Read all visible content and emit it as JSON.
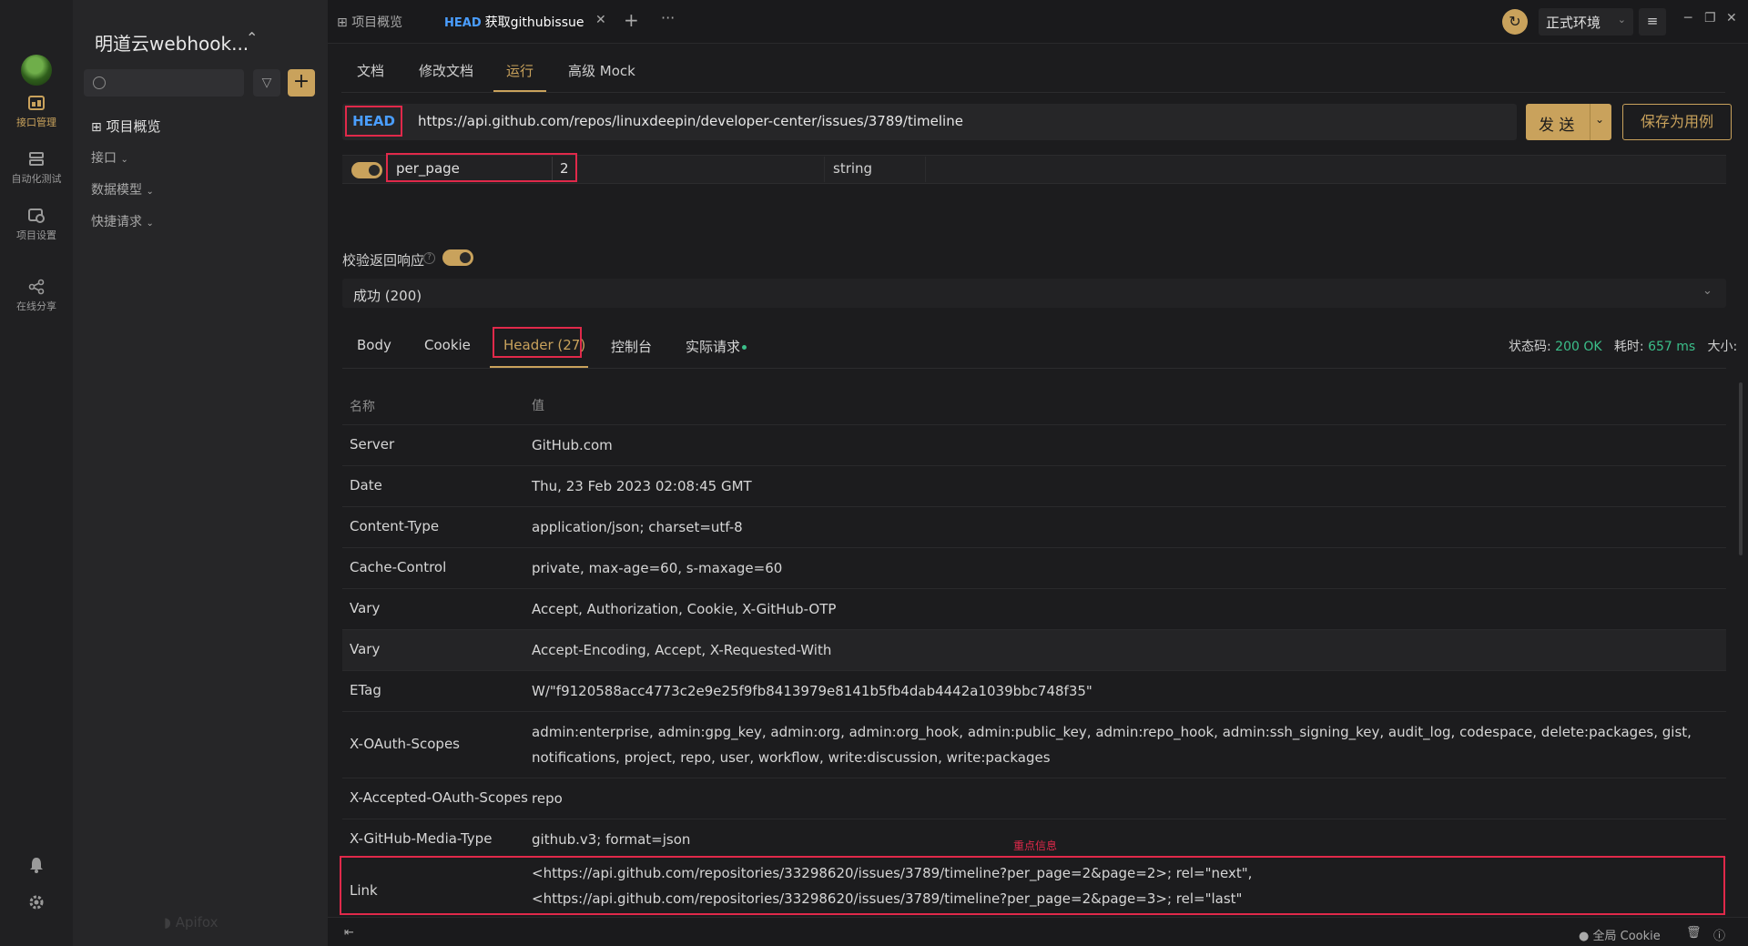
{
  "rail": {
    "items": [
      {
        "label": "接口管理",
        "icon": "api-management-icon"
      },
      {
        "label": "自动化测试",
        "icon": "automated-testing-icon"
      },
      {
        "label": "项目设置",
        "icon": "project-settings-icon"
      },
      {
        "label": "在线分享",
        "icon": "share-icon"
      }
    ]
  },
  "sidebar": {
    "project_title": "明道云webhook...",
    "overview": "项目概览",
    "items": [
      "接口",
      "数据模型",
      "快捷请求"
    ],
    "watermark": "Apifox"
  },
  "tabs": {
    "overview": "项目概览",
    "active_method": "HEAD",
    "active_title": "获取githubissue"
  },
  "env": {
    "name": "正式环境"
  },
  "subtabs": [
    "文档",
    "修改文档",
    "运行",
    "高级 Mock"
  ],
  "request": {
    "method": "HEAD",
    "url": "https://api.github.com/repos/linuxdeepin/developer-center/issues/3789/timeline",
    "send_label": "发 送",
    "save_label": "保存为用例"
  },
  "param": {
    "key": "per_page",
    "value": "2",
    "type": "string"
  },
  "validate": {
    "label": "校验返回响应",
    "response": "成功 (200)"
  },
  "resp_tabs": [
    "Body",
    "Cookie",
    "Header (27)",
    "控制台",
    "实际请求"
  ],
  "status": {
    "code_label": "状态码:",
    "code": "200 OK",
    "time_label": "耗时:",
    "time": "657 ms",
    "size_label": "大小:"
  },
  "headers": {
    "col_name": "名称",
    "col_value": "值",
    "rows": [
      {
        "name": "Server",
        "value": "GitHub.com"
      },
      {
        "name": "Date",
        "value": "Thu, 23 Feb 2023 02:08:45 GMT"
      },
      {
        "name": "Content-Type",
        "value": "application/json; charset=utf-8"
      },
      {
        "name": "Cache-Control",
        "value": "private, max-age=60, s-maxage=60"
      },
      {
        "name": "Vary",
        "value": "Accept, Authorization, Cookie, X-GitHub-OTP"
      },
      {
        "name": "Vary",
        "value": "Accept-Encoding, Accept, X-Requested-With"
      },
      {
        "name": "ETag",
        "value": "W/\"f9120588acc4773c2e9e25f9fb8413979e8141b5fb4dab4442a1039bbc748f35\""
      },
      {
        "name": "X-OAuth-Scopes",
        "value": "admin:enterprise, admin:gpg_key, admin:org, admin:org_hook, admin:public_key, admin:repo_hook, admin:ssh_signing_key, audit_log, codespace, delete:packages, gist, notifications, project, repo, user, workflow, write:discussion, write:packages"
      },
      {
        "name": "X-Accepted-OAuth-Scopes",
        "value": "repo"
      },
      {
        "name": "X-GitHub-Media-Type",
        "value": "github.v3; format=json"
      },
      {
        "name": "Link",
        "value": "<https://api.github.com/repositories/33298620/issues/3789/timeline?per_page=2&page=2>; rel=\"next\", <https://api.github.com/repositories/33298620/issues/3789/timeline?per_page=2&page=3>; rel=\"last\""
      }
    ],
    "note": "重点信息"
  },
  "bottom": {
    "cookie": "全局 Cookie"
  },
  "colors": {
    "accent": "#c9a25c",
    "method_blue": "#4a9eff",
    "highlight_red": "#e0294a",
    "ok_green": "#3bbf8a"
  }
}
